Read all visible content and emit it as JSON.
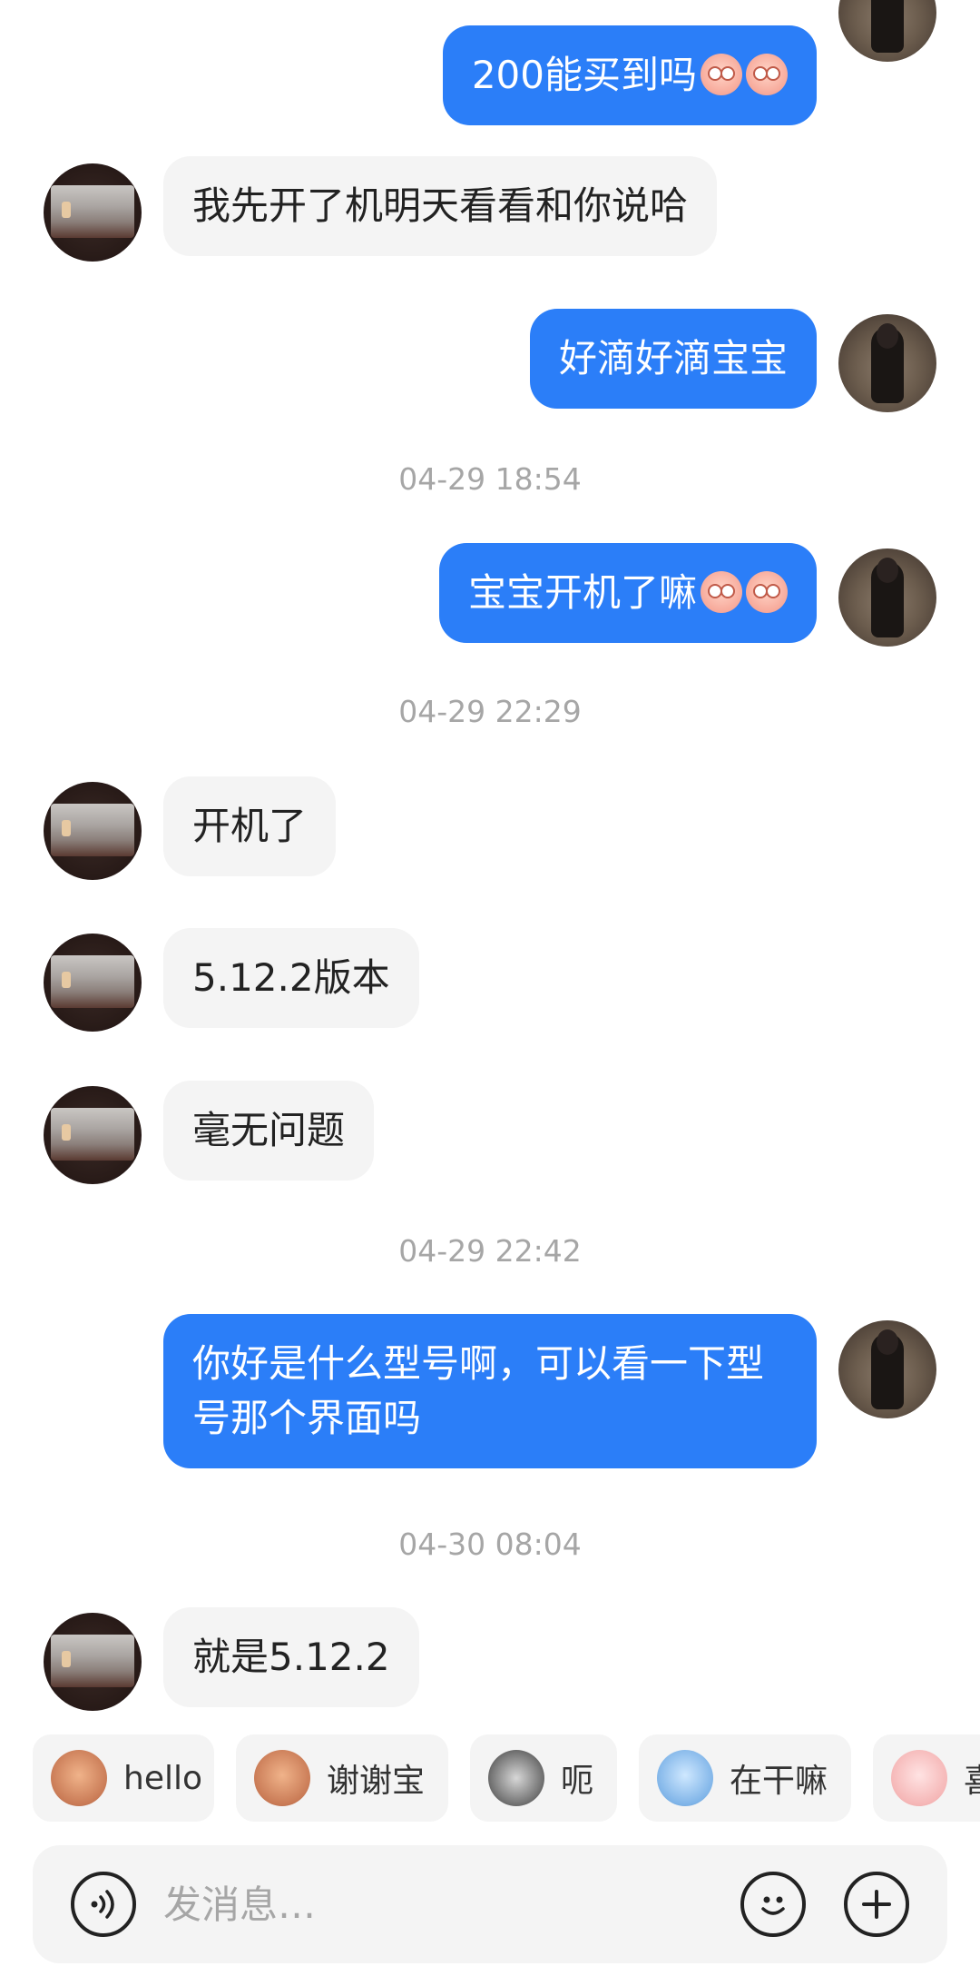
{
  "messages": [
    {
      "type": "out",
      "text": "200能买到吗",
      "emoji": [
        "crying-emoji",
        "crying-emoji"
      ]
    },
    {
      "type": "in",
      "text": "我先开了机明天看看和你说哈"
    },
    {
      "type": "out",
      "text": "好滴好滴宝宝"
    },
    {
      "type": "time",
      "text": "04-29 18:54"
    },
    {
      "type": "out",
      "text": "宝宝开机了嘛",
      "emoji": [
        "pleading-emoji",
        "pleading-emoji"
      ]
    },
    {
      "type": "time",
      "text": "04-29 22:29"
    },
    {
      "type": "in",
      "text": "开机了"
    },
    {
      "type": "in",
      "text": "5.12.2版本"
    },
    {
      "type": "in",
      "text": "毫无问题"
    },
    {
      "type": "time",
      "text": "04-29 22:42"
    },
    {
      "type": "out",
      "text": "你好是什么型号啊，可以看一下型号那个界面吗"
    },
    {
      "type": "time",
      "text": "04-30 08:04"
    },
    {
      "type": "in",
      "text": "就是5.12.2"
    }
  ],
  "quick_replies": [
    {
      "label": "hello",
      "icon": "monkey-sticker-icon"
    },
    {
      "label": "谢谢宝",
      "icon": "monkey-flower-sticker-icon"
    },
    {
      "label": "呃",
      "icon": "cat-sticker-icon"
    },
    {
      "label": "在干嘛",
      "icon": "girl-magnifier-sticker-icon"
    },
    {
      "label": "喜",
      "icon": "pig-sticker-icon"
    }
  ],
  "input": {
    "placeholder": "发消息…",
    "value": "",
    "left_icon": "voice-icon",
    "right_icons": [
      "emoji-face-icon",
      "plus-icon"
    ]
  },
  "colors": {
    "outgoing_bubble": "#2b7ef8",
    "incoming_bubble": "#f4f4f4",
    "timestamp": "#a6a6a6"
  }
}
